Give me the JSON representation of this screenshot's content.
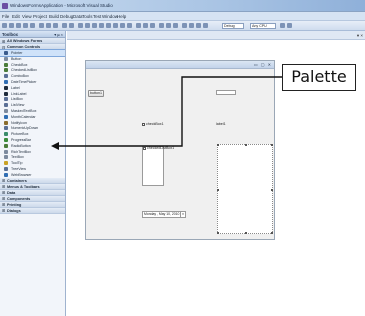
{
  "window": {
    "title": "WindowsFormsApplication - Microsoft Visual Studio"
  },
  "menubar": {
    "items": [
      "File",
      "Edit",
      "View",
      "Project",
      "Build",
      "Debug",
      "Data",
      "Tools",
      "Test",
      "Window",
      "Help"
    ]
  },
  "toolbar": {
    "config_value": "Debug",
    "platform_value": "Any CPU"
  },
  "toolbox": {
    "title": "Toolbox",
    "pin_glyph": "▾ ᵽ ×",
    "groups_top": [
      {
        "arrow": "⊞",
        "label": "All Windows Forms"
      },
      {
        "arrow": "⊟",
        "label": "Common Controls"
      }
    ],
    "items": [
      {
        "label": "Pointer",
        "selected": true,
        "color": "#3a5b8c"
      },
      {
        "label": "Button",
        "color": "#7c8a9e"
      },
      {
        "label": "CheckBox",
        "color": "#4a7c3a"
      },
      {
        "label": "CheckedListBox",
        "color": "#4a7c3a"
      },
      {
        "label": "ComboBox",
        "color": "#5a6f96"
      },
      {
        "label": "DateTimePicker",
        "color": "#2f6db3"
      },
      {
        "label": "Label",
        "color": "#1d2a3a"
      },
      {
        "label": "LinkLabel",
        "color": "#1d2a3a"
      },
      {
        "label": "ListBox",
        "color": "#5a6f96"
      },
      {
        "label": "ListView",
        "color": "#5a6f96"
      },
      {
        "label": "MaskedTextBox",
        "color": "#7c8a9e"
      },
      {
        "label": "MonthCalendar",
        "color": "#2f6db3"
      },
      {
        "label": "NotifyIcon",
        "color": "#8a6d2f"
      },
      {
        "label": "NumericUpDown",
        "color": "#5a6f96"
      },
      {
        "label": "PictureBox",
        "color": "#3a8c6a"
      },
      {
        "label": "ProgressBar",
        "color": "#3a8c3a"
      },
      {
        "label": "RadioButton",
        "color": "#4a7c3a"
      },
      {
        "label": "RichTextBox",
        "color": "#7c8a9e"
      },
      {
        "label": "TextBox",
        "color": "#7c8a9e"
      },
      {
        "label": "ToolTip",
        "color": "#c9a227"
      },
      {
        "label": "TreeView",
        "color": "#5a6f96"
      },
      {
        "label": "WebBrowser",
        "color": "#2f6db3"
      }
    ],
    "groups_bottom": [
      {
        "arrow": "⊞",
        "label": "Containers"
      },
      {
        "arrow": "⊞",
        "label": "Menus & Toolbars"
      },
      {
        "arrow": "⊞",
        "label": "Data"
      },
      {
        "arrow": "⊞",
        "label": "Components"
      },
      {
        "arrow": "⊞",
        "label": "Printing"
      },
      {
        "arrow": "⊞",
        "label": "Dialogs"
      }
    ]
  },
  "designer": {
    "close_glyph": "▾ ×",
    "form_controls_glyph": "▭ ▢ ✕",
    "button_label": "button1",
    "checkbox_label": "checkBox1",
    "checkedlist_label": "checkedListBox1",
    "label_text": "label1",
    "date_text": "Monday , May 10, 2010"
  },
  "annotation": {
    "callout_text": "Palette"
  }
}
